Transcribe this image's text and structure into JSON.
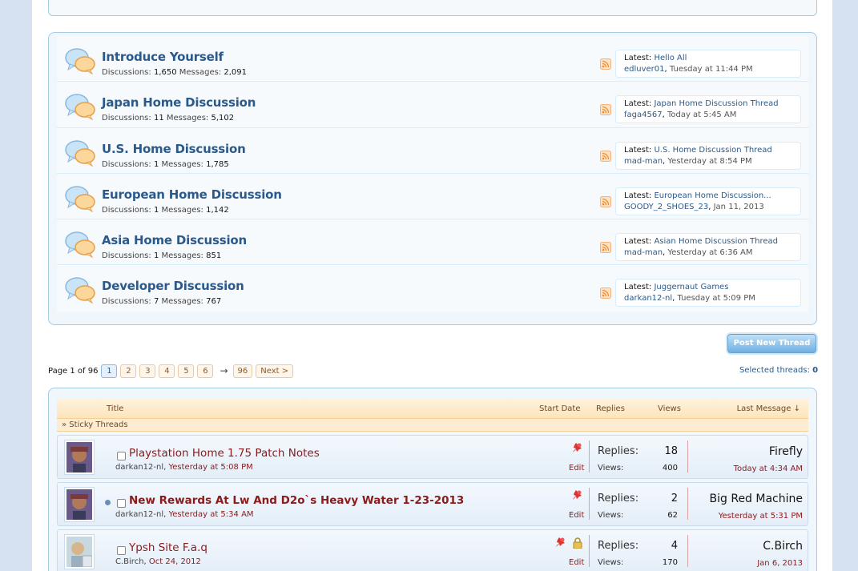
{
  "forums": [
    {
      "title": "Introduce Yourself",
      "discussions_label": "Discussions:",
      "discussions": "1,650",
      "messages_label": "Messages:",
      "messages": "2,091",
      "latest_label": "Latest:",
      "latest_thread": "Hello All",
      "latest_user": "edluver01",
      "latest_time": "Tuesday at 11:44 PM"
    },
    {
      "title": "Japan Home Discussion",
      "discussions_label": "Discussions:",
      "discussions": "11",
      "messages_label": "Messages:",
      "messages": "5,102",
      "latest_label": "Latest:",
      "latest_thread": "Japan Home Discussion Thread",
      "latest_user": "faga4567",
      "latest_time": "Today at 5:45 AM"
    },
    {
      "title": "U.S. Home Discussion",
      "discussions_label": "Discussions:",
      "discussions": "1",
      "messages_label": "Messages:",
      "messages": "1,785",
      "latest_label": "Latest:",
      "latest_thread": "U.S. Home Discussion Thread",
      "latest_user": "mad-man",
      "latest_time": "Yesterday at 8:54 PM"
    },
    {
      "title": "European Home Discussion",
      "discussions_label": "Discussions:",
      "discussions": "1",
      "messages_label": "Messages:",
      "messages": "1,142",
      "latest_label": "Latest:",
      "latest_thread": "European Home Discussion...",
      "latest_user": "GOODY_2_SHOES_23",
      "latest_time": "Jan 11, 2013"
    },
    {
      "title": "Asia Home Discussion",
      "discussions_label": "Discussions:",
      "discussions": "1",
      "messages_label": "Messages:",
      "messages": "851",
      "latest_label": "Latest:",
      "latest_thread": "Asian Home Discussion Thread",
      "latest_user": "mad-man",
      "latest_time": "Yesterday at 6:36 AM"
    },
    {
      "title": "Developer Discussion",
      "discussions_label": "Discussions:",
      "discussions": "7",
      "messages_label": "Messages:",
      "messages": "767",
      "latest_label": "Latest:",
      "latest_thread": "Juggernaut Games",
      "latest_user": "darkan12-nl",
      "latest_time": "Tuesday at 5:09 PM"
    }
  ],
  "post_button": "Post New Thread",
  "pagination": {
    "label": "Page 1 of 96",
    "pages": [
      "1",
      "2",
      "3",
      "4",
      "5",
      "6"
    ],
    "arrow": "→",
    "last": "96",
    "next": "Next >"
  },
  "selected_threads": {
    "label": "Selected threads:",
    "count": "0"
  },
  "thread_list": {
    "col_title": "Title",
    "col_start_date": "Start Date",
    "col_replies": "Replies",
    "col_views": "Views",
    "col_last_message": "Last Message ↓",
    "sticky_label": "» Sticky Threads"
  },
  "threads": [
    {
      "title": "Playstation Home 1.75 Patch Notes",
      "author": "darkan12-nl",
      "date": "Yesterday at 5:08 PM",
      "edit": "Edit",
      "replies_label": "Replies:",
      "replies": "18",
      "views_label": "Views:",
      "views": "400",
      "last_user": "Firefly",
      "last_date": "Today at 4:34 AM"
    },
    {
      "title": "New Rewards At Lw And D2o`s Heavy Water 1-23-2013",
      "author": "darkan12-nl",
      "date": "Yesterday at 5:34 AM",
      "edit": "Edit",
      "replies_label": "Replies:",
      "replies": "2",
      "views_label": "Views:",
      "views": "62",
      "last_user": "Big Red Machine",
      "last_date": "Yesterday at 5:31 PM"
    },
    {
      "title": "Ypsh Site F.a.q",
      "author": "C.Birch",
      "date": "Oct 24, 2012",
      "edit": "Edit",
      "replies_label": "Replies:",
      "replies": "4",
      "views_label": "Views:",
      "views": "170",
      "last_user": "C.Birch",
      "last_date": "Jan 6, 2013"
    }
  ],
  "colors": {
    "link": "#2b5a8a",
    "thread_title": "#8b1a1a",
    "border": "#a5cae4",
    "header_bg": "#fde4bc"
  }
}
